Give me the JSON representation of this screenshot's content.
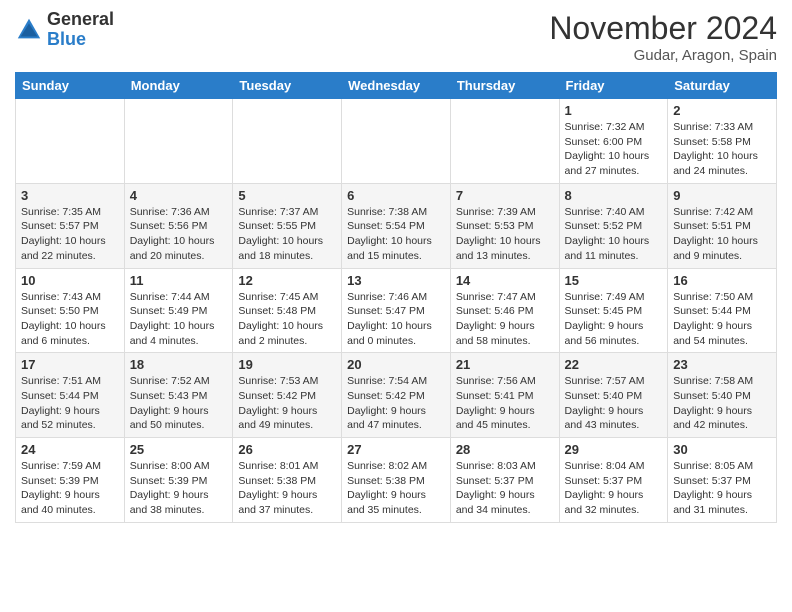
{
  "header": {
    "logo_general": "General",
    "logo_blue": "Blue",
    "month_year": "November 2024",
    "location": "Gudar, Aragon, Spain"
  },
  "days_of_week": [
    "Sunday",
    "Monday",
    "Tuesday",
    "Wednesday",
    "Thursday",
    "Friday",
    "Saturday"
  ],
  "weeks": [
    [
      {
        "day": "",
        "info": ""
      },
      {
        "day": "",
        "info": ""
      },
      {
        "day": "",
        "info": ""
      },
      {
        "day": "",
        "info": ""
      },
      {
        "day": "",
        "info": ""
      },
      {
        "day": "1",
        "info": "Sunrise: 7:32 AM\nSunset: 6:00 PM\nDaylight: 10 hours\nand 27 minutes."
      },
      {
        "day": "2",
        "info": "Sunrise: 7:33 AM\nSunset: 5:58 PM\nDaylight: 10 hours\nand 24 minutes."
      }
    ],
    [
      {
        "day": "3",
        "info": "Sunrise: 7:35 AM\nSunset: 5:57 PM\nDaylight: 10 hours\nand 22 minutes."
      },
      {
        "day": "4",
        "info": "Sunrise: 7:36 AM\nSunset: 5:56 PM\nDaylight: 10 hours\nand 20 minutes."
      },
      {
        "day": "5",
        "info": "Sunrise: 7:37 AM\nSunset: 5:55 PM\nDaylight: 10 hours\nand 18 minutes."
      },
      {
        "day": "6",
        "info": "Sunrise: 7:38 AM\nSunset: 5:54 PM\nDaylight: 10 hours\nand 15 minutes."
      },
      {
        "day": "7",
        "info": "Sunrise: 7:39 AM\nSunset: 5:53 PM\nDaylight: 10 hours\nand 13 minutes."
      },
      {
        "day": "8",
        "info": "Sunrise: 7:40 AM\nSunset: 5:52 PM\nDaylight: 10 hours\nand 11 minutes."
      },
      {
        "day": "9",
        "info": "Sunrise: 7:42 AM\nSunset: 5:51 PM\nDaylight: 10 hours\nand 9 minutes."
      }
    ],
    [
      {
        "day": "10",
        "info": "Sunrise: 7:43 AM\nSunset: 5:50 PM\nDaylight: 10 hours\nand 6 minutes."
      },
      {
        "day": "11",
        "info": "Sunrise: 7:44 AM\nSunset: 5:49 PM\nDaylight: 10 hours\nand 4 minutes."
      },
      {
        "day": "12",
        "info": "Sunrise: 7:45 AM\nSunset: 5:48 PM\nDaylight: 10 hours\nand 2 minutes."
      },
      {
        "day": "13",
        "info": "Sunrise: 7:46 AM\nSunset: 5:47 PM\nDaylight: 10 hours\nand 0 minutes."
      },
      {
        "day": "14",
        "info": "Sunrise: 7:47 AM\nSunset: 5:46 PM\nDaylight: 9 hours\nand 58 minutes."
      },
      {
        "day": "15",
        "info": "Sunrise: 7:49 AM\nSunset: 5:45 PM\nDaylight: 9 hours\nand 56 minutes."
      },
      {
        "day": "16",
        "info": "Sunrise: 7:50 AM\nSunset: 5:44 PM\nDaylight: 9 hours\nand 54 minutes."
      }
    ],
    [
      {
        "day": "17",
        "info": "Sunrise: 7:51 AM\nSunset: 5:44 PM\nDaylight: 9 hours\nand 52 minutes."
      },
      {
        "day": "18",
        "info": "Sunrise: 7:52 AM\nSunset: 5:43 PM\nDaylight: 9 hours\nand 50 minutes."
      },
      {
        "day": "19",
        "info": "Sunrise: 7:53 AM\nSunset: 5:42 PM\nDaylight: 9 hours\nand 49 minutes."
      },
      {
        "day": "20",
        "info": "Sunrise: 7:54 AM\nSunset: 5:42 PM\nDaylight: 9 hours\nand 47 minutes."
      },
      {
        "day": "21",
        "info": "Sunrise: 7:56 AM\nSunset: 5:41 PM\nDaylight: 9 hours\nand 45 minutes."
      },
      {
        "day": "22",
        "info": "Sunrise: 7:57 AM\nSunset: 5:40 PM\nDaylight: 9 hours\nand 43 minutes."
      },
      {
        "day": "23",
        "info": "Sunrise: 7:58 AM\nSunset: 5:40 PM\nDaylight: 9 hours\nand 42 minutes."
      }
    ],
    [
      {
        "day": "24",
        "info": "Sunrise: 7:59 AM\nSunset: 5:39 PM\nDaylight: 9 hours\nand 40 minutes."
      },
      {
        "day": "25",
        "info": "Sunrise: 8:00 AM\nSunset: 5:39 PM\nDaylight: 9 hours\nand 38 minutes."
      },
      {
        "day": "26",
        "info": "Sunrise: 8:01 AM\nSunset: 5:38 PM\nDaylight: 9 hours\nand 37 minutes."
      },
      {
        "day": "27",
        "info": "Sunrise: 8:02 AM\nSunset: 5:38 PM\nDaylight: 9 hours\nand 35 minutes."
      },
      {
        "day": "28",
        "info": "Sunrise: 8:03 AM\nSunset: 5:37 PM\nDaylight: 9 hours\nand 34 minutes."
      },
      {
        "day": "29",
        "info": "Sunrise: 8:04 AM\nSunset: 5:37 PM\nDaylight: 9 hours\nand 32 minutes."
      },
      {
        "day": "30",
        "info": "Sunrise: 8:05 AM\nSunset: 5:37 PM\nDaylight: 9 hours\nand 31 minutes."
      }
    ]
  ]
}
